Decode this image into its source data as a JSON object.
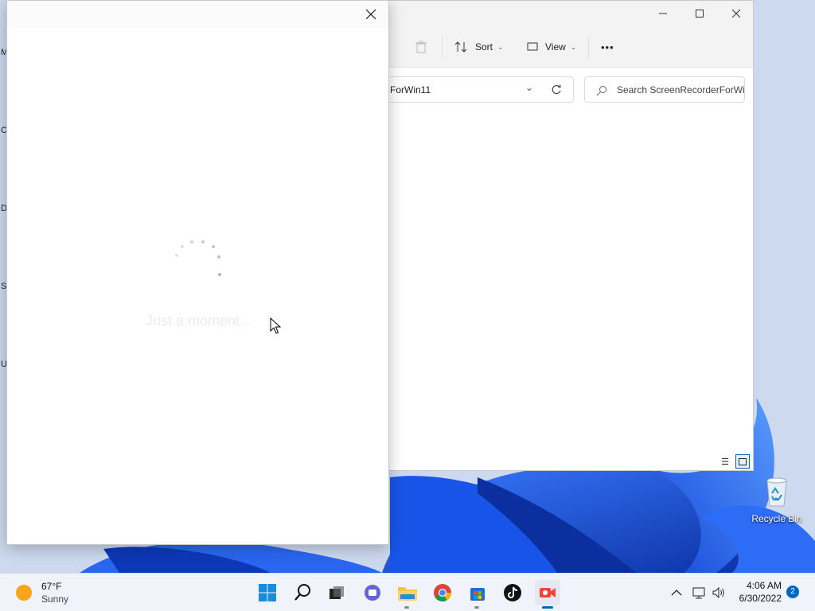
{
  "explorer": {
    "toolbar": {
      "sort_label": "Sort",
      "view_label": "View",
      "more_label": "•••"
    },
    "address": "ForWin11",
    "search_placeholder": "Search ScreenRecorderForWi..."
  },
  "dialog": {
    "loading_text": "Just a moment..."
  },
  "desktop": {
    "recycle_bin_label": "Recycle Bin",
    "left_edge_letters": [
      "M",
      "C",
      "D",
      "S",
      "U"
    ]
  },
  "taskbar": {
    "weather_temp": "67°F",
    "weather_condition": "Sunny",
    "apps": [
      "windows-start",
      "search",
      "task-view",
      "teams-chat",
      "file-explorer",
      "chrome",
      "microsoft-store",
      "tiktok",
      "screen-recorder"
    ],
    "clock_time": "4:06 AM",
    "clock_date": "6/30/2022",
    "notification_count": "2"
  },
  "colors": {
    "accent": "#0067c0",
    "wallpaper_blue": "#0f3fb8"
  }
}
